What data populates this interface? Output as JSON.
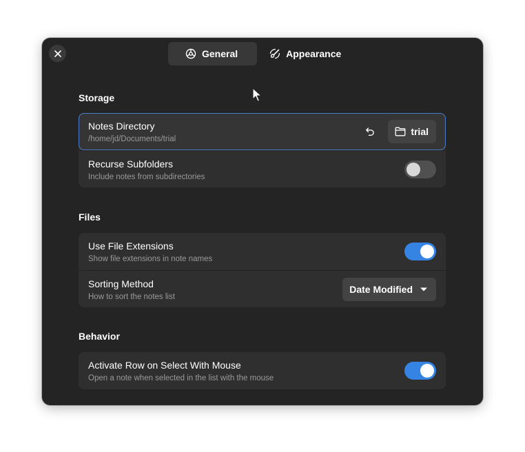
{
  "tabs": [
    {
      "label": "General",
      "icon": "general-settings-icon",
      "active": true
    },
    {
      "label": "Appearance",
      "icon": "appearance-icon",
      "active": false
    }
  ],
  "storage": {
    "title": "Storage",
    "notes_directory": {
      "title": "Notes Directory",
      "path": "/home/jd/Documents/trial",
      "folder_label": "trial"
    },
    "recurse_subfolders": {
      "title": "Recurse Subfolders",
      "subtitle": "Include notes from subdirectories",
      "enabled": false
    }
  },
  "files": {
    "title": "Files",
    "use_file_extensions": {
      "title": "Use File Extensions",
      "subtitle": "Show file extensions in note names",
      "enabled": true
    },
    "sorting_method": {
      "title": "Sorting Method",
      "subtitle": "How to sort the notes list",
      "selected": "Date Modified"
    }
  },
  "behavior": {
    "title": "Behavior",
    "activate_row": {
      "title": "Activate Row on Select With Mouse",
      "subtitle": "Open a note when selected in the list with the mouse",
      "enabled": true
    }
  },
  "colors": {
    "window_bg": "#242424",
    "card_bg": "#2f2f2f",
    "accent": "#3584e4",
    "focus_border": "#4a7ec8"
  }
}
